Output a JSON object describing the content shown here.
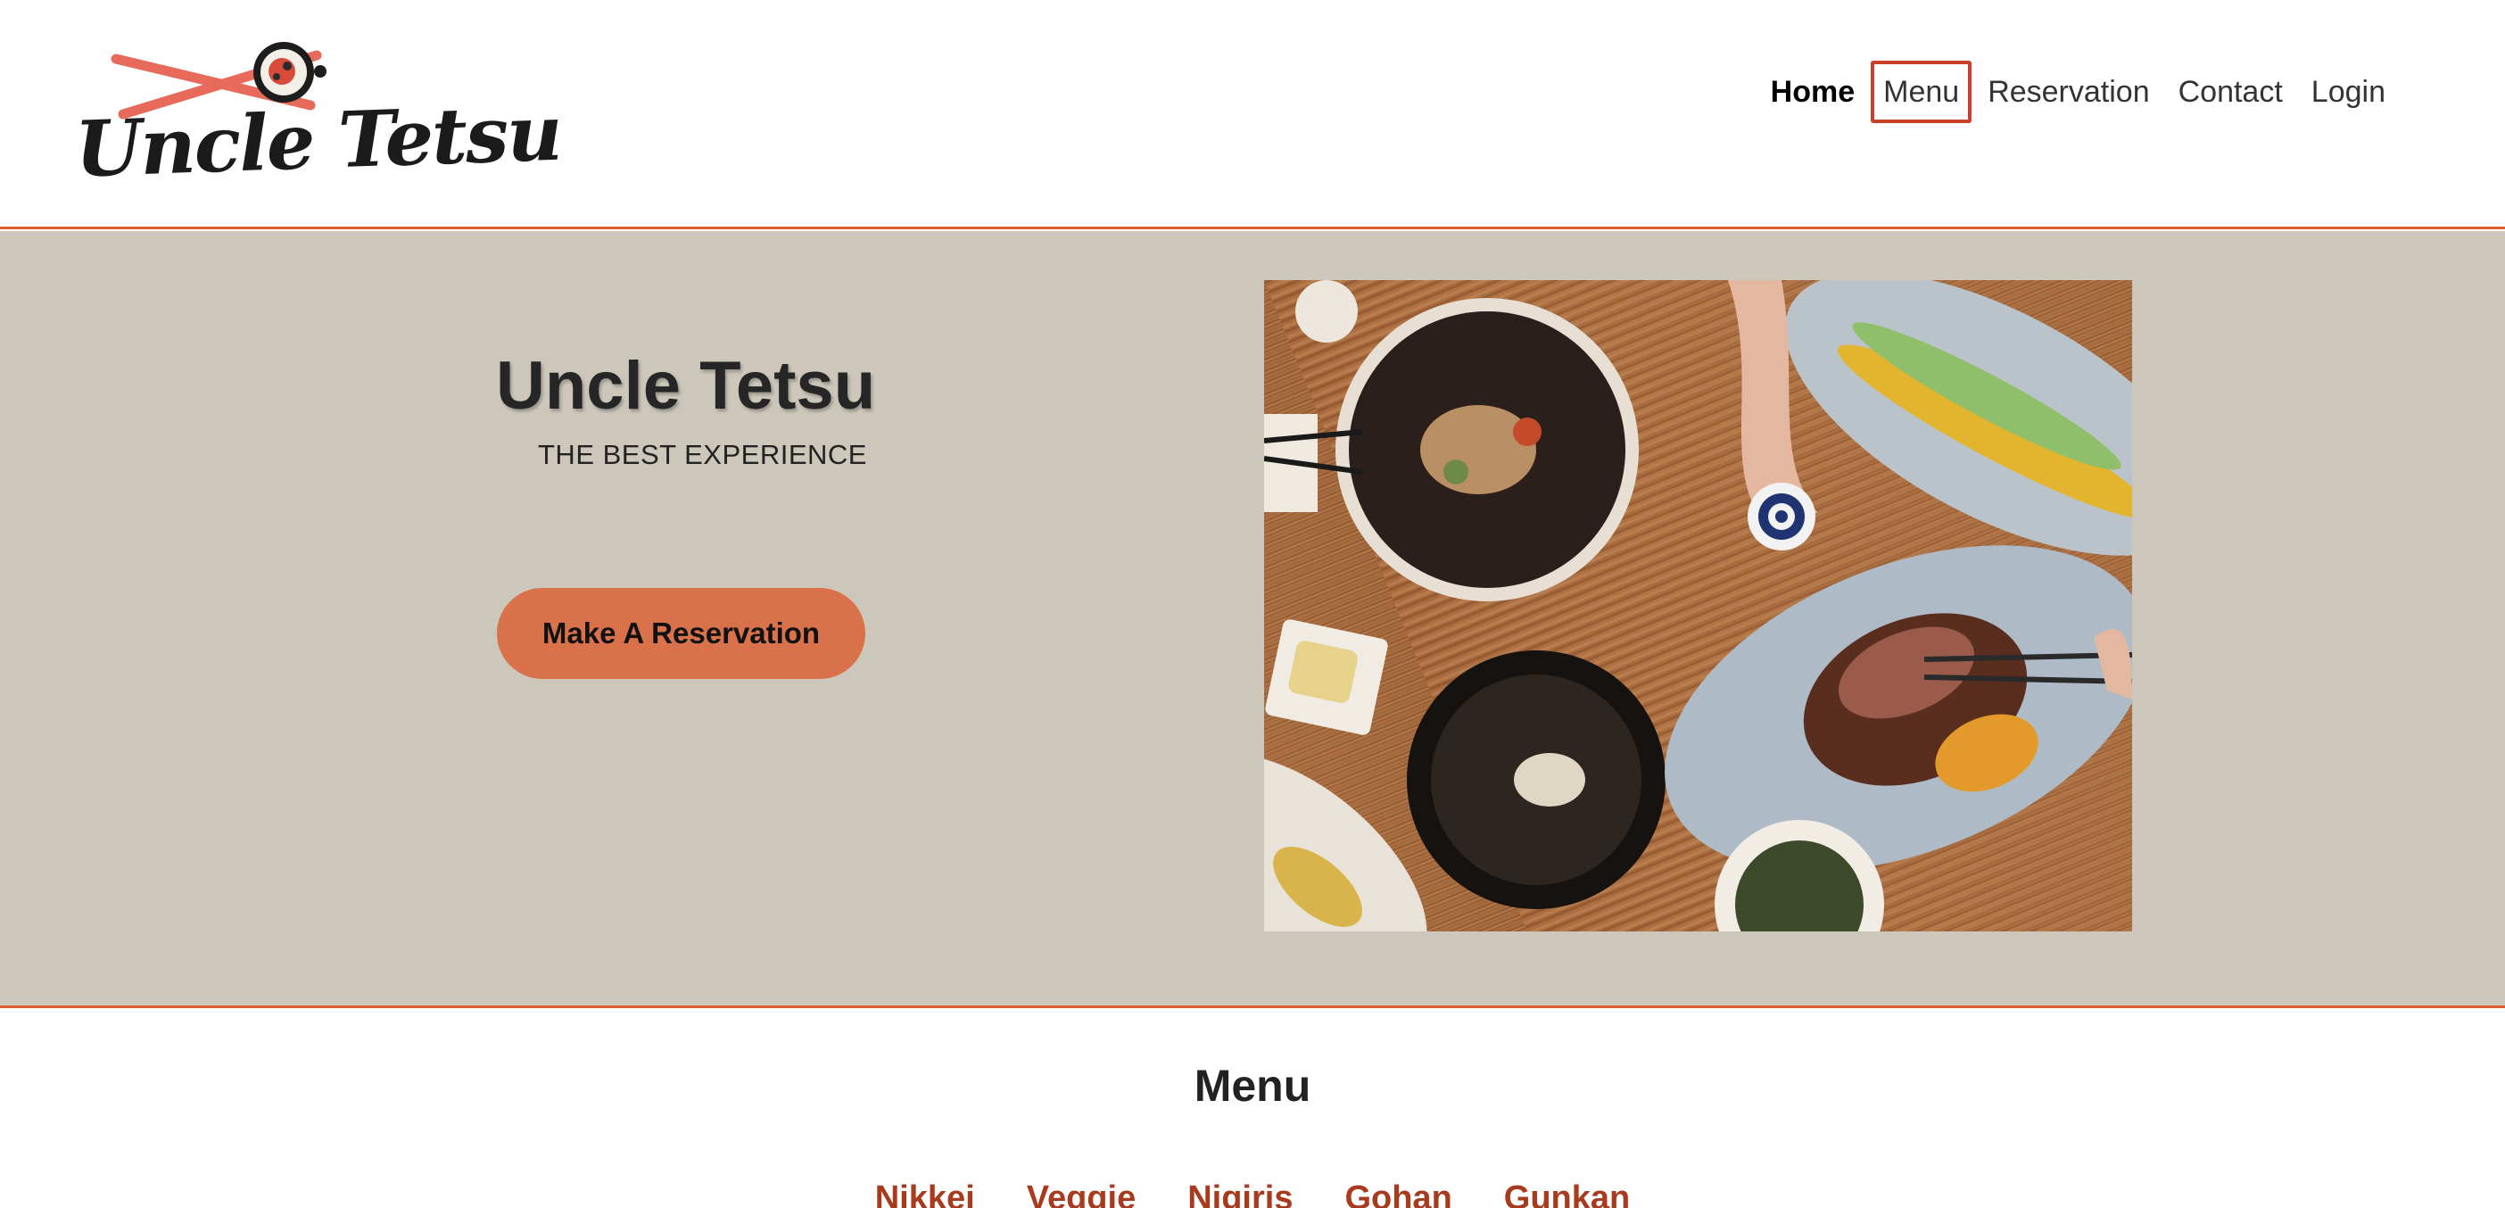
{
  "header": {
    "logo_text": "Uncle Tetsu",
    "nav": [
      {
        "label": "Home",
        "state": "active"
      },
      {
        "label": "Menu",
        "state": "focused"
      },
      {
        "label": "Reservation",
        "state": "normal"
      },
      {
        "label": "Contact",
        "state": "normal"
      },
      {
        "label": "Login",
        "state": "normal"
      }
    ]
  },
  "hero": {
    "title": "Uncle Tetsu",
    "subtitle": "THE BEST EXPERIENCE",
    "button_label": "Make A Reservation"
  },
  "menu": {
    "title": "Menu",
    "tabs": [
      "Nikkei",
      "Veggie",
      "Nigiris",
      "Gohan",
      "Gunkan"
    ]
  },
  "colors": {
    "accent": "#d9622e",
    "button": "#d9714a",
    "hero_bg": "#cdc7bb",
    "tab_text": "#a83a1e",
    "focus_outline": "#c8402a"
  },
  "icons": {
    "logo": "chopsticks-sushi-roll-logo"
  }
}
